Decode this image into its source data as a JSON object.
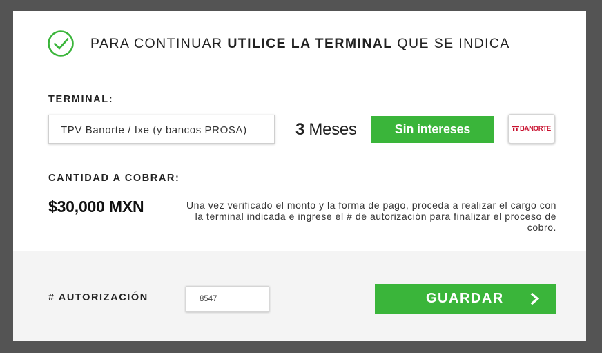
{
  "header": {
    "title_prefix": "PARA CONTINUAR ",
    "title_bold": "UTILICE LA TERMINAL",
    "title_suffix": " QUE SE INDICA",
    "icon": "check-circle-icon"
  },
  "terminal": {
    "label": "TERMINAL:",
    "value": "TPV Banorte / Ixe (y bancos PROSA)",
    "months_number": "3",
    "months_text": " Meses",
    "badge": "Sin intereses",
    "bank_logo_text": "BANORTE"
  },
  "amount": {
    "label": "CANTIDAD A COBRAR:",
    "value": "$30,000 MXN",
    "instructions": "Una vez verificado el monto y la forma de pago, proceda a realizar el cargo con la terminal indicada e ingrese el # de autorización para finalizar el proceso de cobro."
  },
  "footer": {
    "auth_label": "# AUTORIZACIÓN",
    "auth_value": "8547",
    "save_label": "GUARDAR",
    "save_icon": "chevron-right-icon"
  },
  "colors": {
    "accent_green": "#3ab53a",
    "banorte_red": "#c8102e",
    "backdrop": "#545454"
  }
}
